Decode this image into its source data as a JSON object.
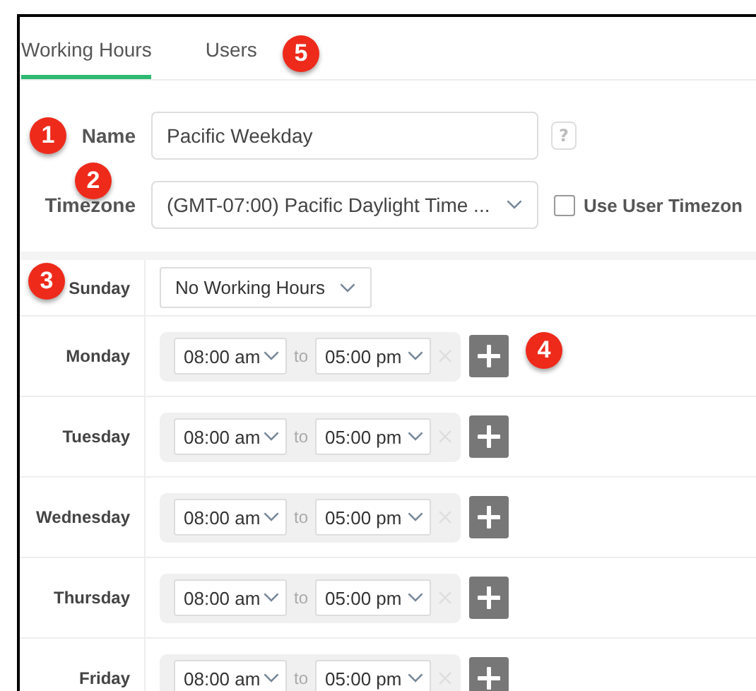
{
  "tabs": [
    {
      "label": "Working Hours",
      "selected": true
    },
    {
      "label": "Users",
      "selected": false,
      "callout": "5"
    }
  ],
  "form": {
    "name_label": "Name",
    "name_callout": "1",
    "name_value": "Pacific Weekday",
    "help": "?",
    "timezone_label": "Timezone",
    "timezone_callout": "2",
    "timezone_value": "(GMT-07:00) Pacific Daylight Time ...",
    "use_user_timezone": {
      "label": "Use User Timezon",
      "checked": false
    }
  },
  "days": [
    {
      "day": "Sunday",
      "kind": "none",
      "value": "No Working Hours",
      "callout": "3"
    },
    {
      "day": "Monday",
      "kind": "hours",
      "from": "08:00 am",
      "separator": "to",
      "to": "05:00 pm",
      "callout": "4"
    },
    {
      "day": "Tuesday",
      "kind": "hours",
      "from": "08:00 am",
      "separator": "to",
      "to": "05:00 pm"
    },
    {
      "day": "Wednesday",
      "kind": "hours",
      "from": "08:00 am",
      "separator": "to",
      "to": "05:00 pm"
    },
    {
      "day": "Thursday",
      "kind": "hours",
      "from": "08:00 am",
      "separator": "to",
      "to": "05:00 pm"
    },
    {
      "day": "Friday",
      "kind": "hours",
      "from": "08:00 am",
      "separator": "to",
      "to": "05:00 pm"
    }
  ]
}
